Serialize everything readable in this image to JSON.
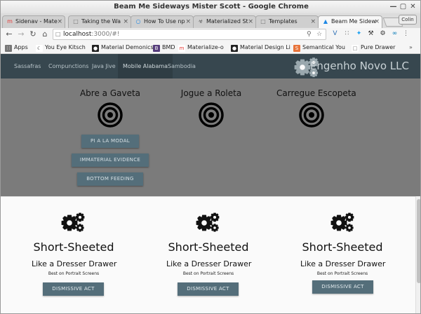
{
  "window": {
    "title": "Beam Me Sideways Mister Scott - Google Chrome"
  },
  "tabs": [
    {
      "label": "Sidenav - Mate",
      "icon": "materialize-icon",
      "color": "#e53935"
    },
    {
      "label": "Taking the Wa",
      "icon": "document-icon",
      "color": "#777777"
    },
    {
      "label": "How To Use np",
      "icon": "logo-icon",
      "color": "#1e88e5"
    },
    {
      "label": "Materialized St",
      "icon": "biohazard-icon",
      "color": "#555555"
    },
    {
      "label": "Templates",
      "icon": "document-icon",
      "color": "#777777"
    },
    {
      "label": "Beam Me Sidew",
      "icon": "logo-icon",
      "color": "#1e88e5"
    }
  ],
  "profile": {
    "label": "Colin"
  },
  "toolbar": {
    "url_host": "localhost",
    "url_rest": ":3000/#!"
  },
  "bookmarks": [
    {
      "label": "Apps",
      "icon": "apps-icon",
      "color": "#555555"
    },
    {
      "label": "You Eye Kitsch",
      "icon": "moon-icon",
      "color": "#333333"
    },
    {
      "label": "Material Demonics",
      "icon": "github-icon",
      "color": "#222222"
    },
    {
      "label": "BMD",
      "icon": "bootstrap-icon",
      "color": "#563d7c"
    },
    {
      "label": "Materialize-o",
      "icon": "materialize-icon",
      "color": "#e53935"
    },
    {
      "label": "Material Design Li",
      "icon": "github-icon",
      "color": "#222222"
    },
    {
      "label": "Semantical You",
      "icon": "semantic-icon",
      "color": "#e8743b"
    },
    {
      "label": "Pure Drawer",
      "icon": "document-icon",
      "color": "#777777"
    }
  ],
  "appnav": {
    "items": [
      "Sassafras",
      "Compunctions",
      "Java Jive",
      "Mobile Alabama",
      "Sambodia"
    ],
    "active_index": 3,
    "brand": "Engenho Novo LLC"
  },
  "targets": [
    {
      "label": "Abre a Gaveta"
    },
    {
      "label": "Jogue a Roleta"
    },
    {
      "label": "Carregue Escopeta"
    }
  ],
  "modal_buttons": [
    "PI A LA MODAL",
    "IMMATERIAL EVIDENCE",
    "BOTTOM FEEDING"
  ],
  "drawer_cards": [
    {
      "title": "Short-Sheeted",
      "subtitle": "Like a Dresser Drawer",
      "note": "Best on Portrait Screens",
      "button": "DISMISSIVE ACT"
    },
    {
      "title": "Short-Sheeted",
      "subtitle": "Like a Dresser Drawer",
      "note": "Best on Portrait Screens",
      "button": "DISMISSIVE ACT"
    },
    {
      "title": "Short-Sheeted",
      "subtitle": "Like a Dresser Drawer",
      "note": "Best on Portrait Screens",
      "button": "DISMISSIVE ACT"
    }
  ],
  "colors": {
    "nav": "#37474f",
    "button": "#546e7a",
    "overlay": "#7b7b7b"
  }
}
